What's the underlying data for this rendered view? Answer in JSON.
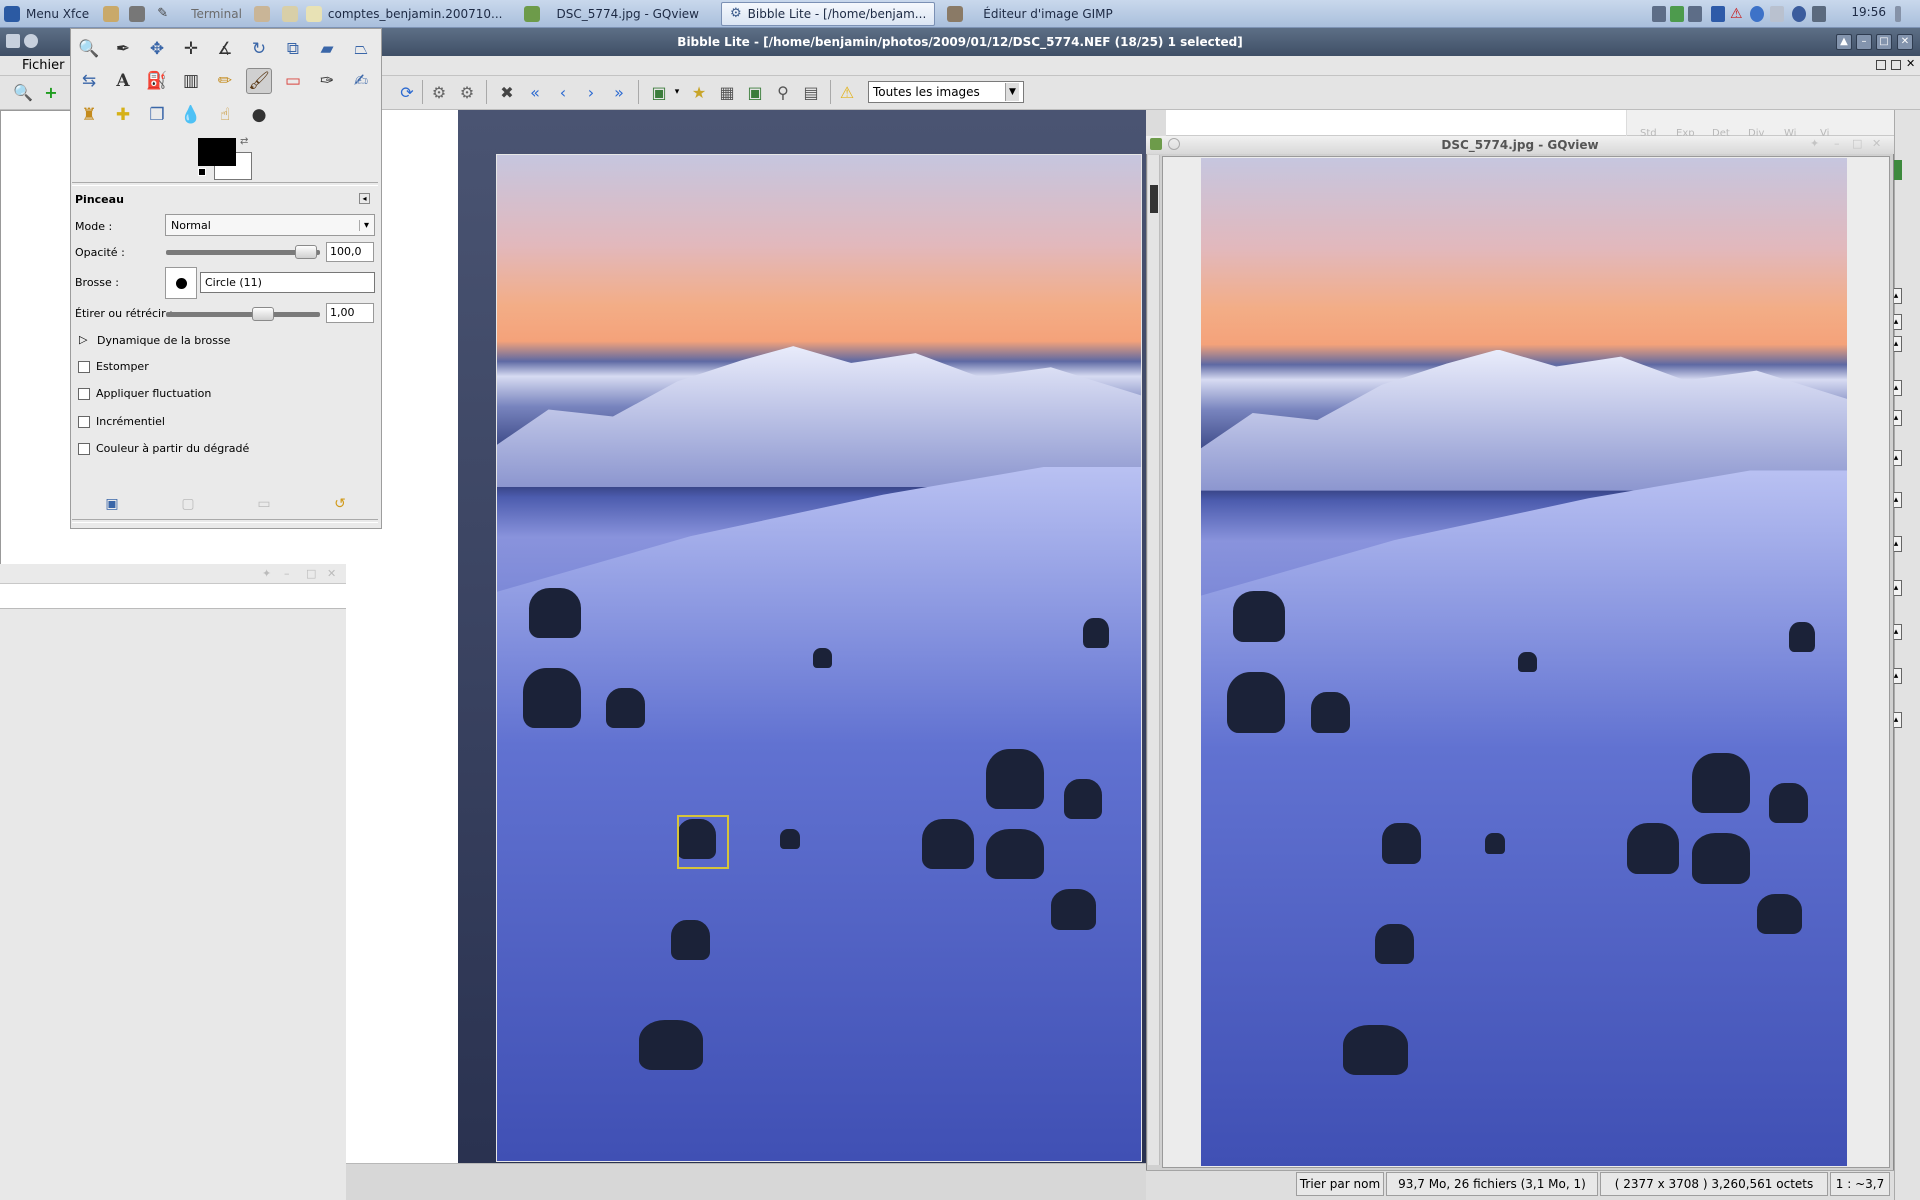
{
  "top_panel": {
    "menu_label": "Menu Xfce",
    "tasks": [
      {
        "label": "Terminal"
      },
      {
        "label": "comptes_benjamin.200710..."
      },
      {
        "label": "DSC_5774.jpg - GQview"
      },
      {
        "label": "Bibble Lite - [/home/benjam..."
      },
      {
        "label": "Éditeur d'image GIMP"
      }
    ],
    "clock": "19:56"
  },
  "bibble": {
    "title": "Bibble Lite - [/home/benjamin/photos/2009/01/12/DSC_5774.NEF (18/25) 1 selected]",
    "menu": {
      "fichier": "Fichier"
    },
    "filter_value": "Toutes les images"
  },
  "gimp": {
    "tool_options_title": "Pinceau",
    "mode_label": "Mode :",
    "mode_value": "Normal",
    "opacity_label": "Opacité :",
    "opacity_value": "100,0",
    "brush_label": "Brosse :",
    "brush_value": "Circle (11)",
    "scale_label": "Étirer ou rétrécir :",
    "scale_value": "1,00",
    "dynamics_label": "Dynamique de la brosse",
    "options": [
      {
        "label": "Estomper",
        "checked": false
      },
      {
        "label": "Appliquer fluctuation",
        "checked": false
      },
      {
        "label": "Incrémentiel",
        "checked": false
      },
      {
        "label": "Couleur à partir du dégradé",
        "checked": false
      }
    ],
    "fg_color": "#000000",
    "bg_color": "#ffffff"
  },
  "gqview": {
    "title": "DSC_5774.jpg - GQview",
    "status": {
      "sort": "Trier par nom",
      "summary": "93,7 Mo, 26 fichiers (3,1 Mo, 1)",
      "dimensions": "( 2377 x 3708 ) 3,260,561 octets",
      "zoom": "1 : ~3,7"
    }
  },
  "right_tabs": [
    "Std",
    "Exp",
    "Det",
    "Div",
    "Wi",
    "Vi"
  ]
}
